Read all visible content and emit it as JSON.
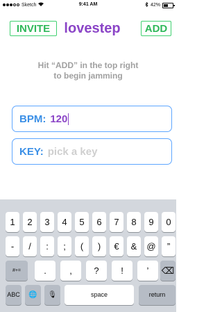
{
  "status": {
    "carrier": "Sketch",
    "time": "9:41 AM",
    "battery": "42%"
  },
  "topbar": {
    "invite_label": "INVITE",
    "title": "lovestep",
    "add_label": "ADD"
  },
  "hint": {
    "line1": "Hit “ADD” in the top right",
    "line2": "to begin jamming"
  },
  "bpm": {
    "label": "BPM:",
    "value": "120"
  },
  "key": {
    "label": "KEY:",
    "placeholder": "pick a key"
  },
  "keyboard": {
    "row1": [
      "1",
      "2",
      "3",
      "4",
      "5",
      "6",
      "7",
      "8",
      "9",
      "0"
    ],
    "row2": [
      "-",
      "/",
      ":",
      ";",
      "(",
      ")",
      "€",
      "&",
      "@",
      "”"
    ],
    "row3_mode": "#+=",
    "row3": [
      ".",
      ",",
      "?",
      "!",
      "’"
    ],
    "row3_delete": "⌫",
    "bottom_abc": "ABC",
    "bottom_globe": "🌐",
    "bottom_mic": "🎙",
    "space": "space",
    "return": "return"
  }
}
